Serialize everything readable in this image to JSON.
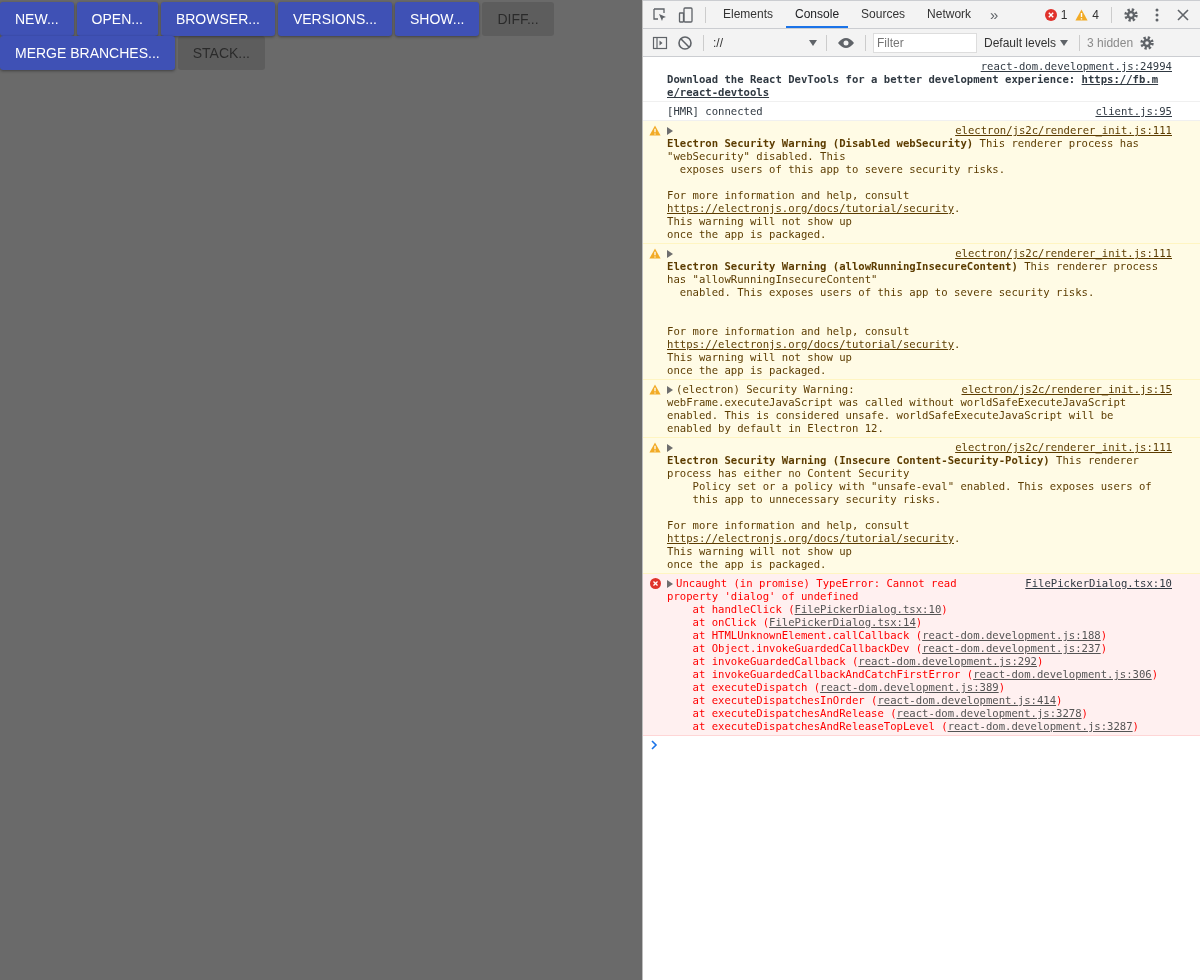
{
  "left_panel": {
    "button_rows": [
      [
        {
          "label": "NEW...",
          "disabled": false
        },
        {
          "label": "OPEN...",
          "disabled": false
        },
        {
          "label": "BROWSER...",
          "disabled": false
        },
        {
          "label": "VERSIONS...",
          "disabled": false
        },
        {
          "label": "SHOW...",
          "disabled": false
        },
        {
          "label": "DIFF...",
          "disabled": true
        }
      ],
      [
        {
          "label": "MERGE BRANCHES...",
          "disabled": false
        },
        {
          "label": "STACK...",
          "disabled": true
        }
      ]
    ]
  },
  "devtools": {
    "tabs": [
      {
        "label": "Elements",
        "selected": false
      },
      {
        "label": "Console",
        "selected": true
      },
      {
        "label": "Sources",
        "selected": false
      },
      {
        "label": "Network",
        "selected": false
      }
    ],
    "overflow": "»",
    "error_count": "1",
    "warning_count": "4",
    "console_toolbar": {
      "context": "://",
      "filter": {
        "placeholder": "Filter"
      },
      "levels": "Default levels",
      "hidden": "3 hidden"
    },
    "messages": [
      {
        "kind": "info",
        "expandable": false,
        "source": "react-dom.development.js:24994",
        "lines": [
          {
            "kind": "text",
            "segs": [
              {
                "text": "Download the React DevTools for a better development experience: ",
                "kind": "bold"
              },
              {
                "text": "https://fb.m",
                "kind": "bold_link"
              }
            ]
          },
          {
            "kind": "text",
            "segs": [
              {
                "text": "e/react-devtools",
                "kind": "bold_link"
              }
            ]
          }
        ]
      },
      {
        "kind": "info",
        "expandable": false,
        "head": "[HMR] connected",
        "source": "client.js:95"
      },
      {
        "kind": "warning",
        "expandable": true,
        "source": "electron/js2c/renderer_init.js:111",
        "lines": [
          {
            "kind": "text",
            "segs": [
              {
                "text": "Electron Security Warning (Disabled webSecurity)",
                "kind": "bold"
              },
              {
                "text": " This renderer process has",
                "kind": "plain"
              }
            ]
          },
          {
            "kind": "text",
            "segs": [
              {
                "text": "\"webSecurity\" disabled. This",
                "kind": "plain"
              }
            ]
          },
          {
            "kind": "text",
            "segs": [
              {
                "text": "  exposes users of this app to severe security risks.",
                "kind": "plain"
              }
            ]
          },
          {
            "kind": "blank"
          },
          {
            "kind": "text",
            "segs": [
              {
                "text": "For more information and help, consult",
                "kind": "plain"
              }
            ]
          },
          {
            "kind": "text",
            "segs": [
              {
                "text": "https://electronjs.org/docs/tutorial/security",
                "kind": "link"
              },
              {
                "text": ".",
                "kind": "plain"
              }
            ]
          },
          {
            "kind": "text",
            "segs": [
              {
                "text": "This warning will not show up",
                "kind": "plain"
              }
            ]
          },
          {
            "kind": "text",
            "segs": [
              {
                "text": "once the app is packaged.",
                "kind": "plain"
              }
            ]
          }
        ]
      },
      {
        "kind": "warning",
        "expandable": true,
        "source": "electron/js2c/renderer_init.js:111",
        "lines": [
          {
            "kind": "text",
            "segs": [
              {
                "text": "Electron Security Warning (allowRunningInsecureContent)",
                "kind": "bold"
              },
              {
                "text": " This renderer process",
                "kind": "plain"
              }
            ]
          },
          {
            "kind": "text",
            "segs": [
              {
                "text": "has \"allowRunningInsecureContent\"",
                "kind": "plain"
              }
            ]
          },
          {
            "kind": "text",
            "segs": [
              {
                "text": "  enabled. This exposes users of this app to severe security risks.",
                "kind": "plain"
              }
            ]
          },
          {
            "kind": "blank"
          },
          {
            "kind": "blank"
          },
          {
            "kind": "text",
            "segs": [
              {
                "text": "For more information and help, consult",
                "kind": "plain"
              }
            ]
          },
          {
            "kind": "text",
            "segs": [
              {
                "text": "https://electronjs.org/docs/tutorial/security",
                "kind": "link"
              },
              {
                "text": ".",
                "kind": "plain"
              }
            ]
          },
          {
            "kind": "text",
            "segs": [
              {
                "text": "This warning will not show up",
                "kind": "plain"
              }
            ]
          },
          {
            "kind": "text",
            "segs": [
              {
                "text": "once the app is packaged.",
                "kind": "plain"
              }
            ]
          }
        ]
      },
      {
        "kind": "warning",
        "expandable": true,
        "head": "(electron) Security Warning:",
        "source": "electron/js2c/renderer_init.js:15",
        "lines": [
          {
            "kind": "text",
            "segs": [
              {
                "text": "webFrame.executeJavaScript was called without worldSafeExecuteJavaScript",
                "kind": "plain"
              }
            ]
          },
          {
            "kind": "text",
            "segs": [
              {
                "text": "enabled. This is considered unsafe. worldSafeExecuteJavaScript will be",
                "kind": "plain"
              }
            ]
          },
          {
            "kind": "text",
            "segs": [
              {
                "text": "enabled by default in Electron 12.",
                "kind": "plain"
              }
            ]
          }
        ]
      },
      {
        "kind": "warning",
        "expandable": true,
        "source": "electron/js2c/renderer_init.js:111",
        "lines": [
          {
            "kind": "text",
            "segs": [
              {
                "text": "Electron Security Warning (Insecure Content-Security-Policy)",
                "kind": "bold"
              },
              {
                "text": " This renderer",
                "kind": "plain"
              }
            ]
          },
          {
            "kind": "text",
            "segs": [
              {
                "text": "process has either no Content Security",
                "kind": "plain"
              }
            ]
          },
          {
            "kind": "text",
            "segs": [
              {
                "text": "    Policy set or a policy with \"unsafe-eval\" enabled. This exposes users of",
                "kind": "plain"
              }
            ]
          },
          {
            "kind": "text",
            "segs": [
              {
                "text": "    this app to unnecessary security risks.",
                "kind": "plain"
              }
            ]
          },
          {
            "kind": "blank"
          },
          {
            "kind": "text",
            "segs": [
              {
                "text": "For more information and help, consult",
                "kind": "plain"
              }
            ]
          },
          {
            "kind": "text",
            "segs": [
              {
                "text": "https://electronjs.org/docs/tutorial/security",
                "kind": "link"
              },
              {
                "text": ".",
                "kind": "plain"
              }
            ]
          },
          {
            "kind": "text",
            "segs": [
              {
                "text": "This warning will not show up",
                "kind": "plain"
              }
            ]
          },
          {
            "kind": "text",
            "segs": [
              {
                "text": "once the app is packaged.",
                "kind": "plain"
              }
            ]
          }
        ]
      },
      {
        "kind": "error",
        "expandable": true,
        "head": "Uncaught (in promise) TypeError: Cannot read",
        "source": "FilePickerDialog.tsx:10",
        "lines": [
          {
            "kind": "text",
            "segs": [
              {
                "text": "property 'dialog' of undefined",
                "kind": "plain"
              }
            ]
          },
          {
            "kind": "text",
            "segs": [
              {
                "text": "    at handleClick (",
                "kind": "plain"
              },
              {
                "text": "FilePickerDialog.tsx:10",
                "kind": "link"
              },
              {
                "text": ")",
                "kind": "plain"
              }
            ]
          },
          {
            "kind": "text",
            "segs": [
              {
                "text": "    at onClick (",
                "kind": "plain"
              },
              {
                "text": "FilePickerDialog.tsx:14",
                "kind": "link"
              },
              {
                "text": ")",
                "kind": "plain"
              }
            ]
          },
          {
            "kind": "text",
            "segs": [
              {
                "text": "    at HTMLUnknownElement.callCallback (",
                "kind": "plain"
              },
              {
                "text": "react-dom.development.js:188",
                "kind": "link"
              },
              {
                "text": ")",
                "kind": "plain"
              }
            ]
          },
          {
            "kind": "text",
            "segs": [
              {
                "text": "    at Object.invokeGuardedCallbackDev (",
                "kind": "plain"
              },
              {
                "text": "react-dom.development.js:237",
                "kind": "link"
              },
              {
                "text": ")",
                "kind": "plain"
              }
            ]
          },
          {
            "kind": "text",
            "segs": [
              {
                "text": "    at invokeGuardedCallback (",
                "kind": "plain"
              },
              {
                "text": "react-dom.development.js:292",
                "kind": "link"
              },
              {
                "text": ")",
                "kind": "plain"
              }
            ]
          },
          {
            "kind": "text",
            "segs": [
              {
                "text": "    at invokeGuardedCallbackAndCatchFirstError (",
                "kind": "plain"
              },
              {
                "text": "react-dom.development.js:306",
                "kind": "link"
              },
              {
                "text": ")",
                "kind": "plain"
              }
            ]
          },
          {
            "kind": "text",
            "segs": [
              {
                "text": "    at executeDispatch (",
                "kind": "plain"
              },
              {
                "text": "react-dom.development.js:389",
                "kind": "link"
              },
              {
                "text": ")",
                "kind": "plain"
              }
            ]
          },
          {
            "kind": "text",
            "segs": [
              {
                "text": "    at executeDispatchesInOrder (",
                "kind": "plain"
              },
              {
                "text": "react-dom.development.js:414",
                "kind": "link"
              },
              {
                "text": ")",
                "kind": "plain"
              }
            ]
          },
          {
            "kind": "text",
            "segs": [
              {
                "text": "    at executeDispatchesAndRelease (",
                "kind": "plain"
              },
              {
                "text": "react-dom.development.js:3278",
                "kind": "link"
              },
              {
                "text": ")",
                "kind": "plain"
              }
            ]
          },
          {
            "kind": "text",
            "segs": [
              {
                "text": "    at executeDispatchesAndReleaseTopLevel (",
                "kind": "plain"
              },
              {
                "text": "react-dom.development.js:3287",
                "kind": "link"
              },
              {
                "text": ")",
                "kind": "plain"
              }
            ]
          }
        ]
      }
    ]
  }
}
